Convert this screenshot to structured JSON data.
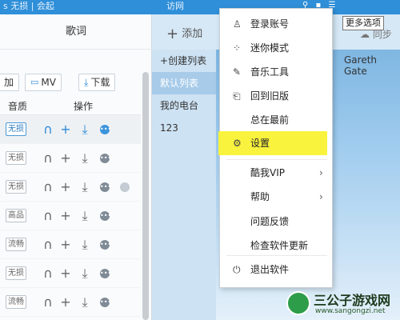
{
  "titlebar": {
    "left_text": "s 无损 | 会起",
    "center_text": "访网",
    "icons": [
      "user-icon",
      "skin-icon",
      "menu-icon"
    ]
  },
  "left_panel": {
    "lyrics_tab": "歌词",
    "buttons": {
      "add_partial": "加",
      "mv": "MV",
      "download": "下载"
    },
    "columns": {
      "quality": "音质",
      "actions": "操作"
    },
    "rows": [
      {
        "quality": "无损",
        "highlighted": true
      },
      {
        "quality": "无损",
        "highlighted": false
      },
      {
        "quality": "无损",
        "highlighted": false
      },
      {
        "quality": "高品",
        "highlighted": false
      },
      {
        "quality": "流畅",
        "highlighted": false
      },
      {
        "quality": "无损",
        "highlighted": false
      },
      {
        "quality": "流畅",
        "highlighted": false
      }
    ]
  },
  "mid_panel": {
    "add_label": "添加",
    "create_list": "创建列表",
    "items": [
      "默认列表",
      "我的电台",
      "123"
    ],
    "selected_index": 0
  },
  "right_panel": {
    "artist": "Gareth Gate",
    "sync_label": "同步"
  },
  "tooltip": "更多选项",
  "menu": {
    "items": [
      {
        "label": "登录账号",
        "icon": "user-icon"
      },
      {
        "label": "迷你模式",
        "icon": "mini-mode-icon"
      },
      {
        "label": "音乐工具",
        "icon": "tools-icon"
      },
      {
        "label": "回到旧版",
        "icon": "old-version-icon"
      },
      {
        "label": "总在最前",
        "icon": ""
      },
      {
        "label": "设置",
        "icon": "gear-icon",
        "highlighted": true
      },
      {
        "label": "酷我VIP",
        "icon": "",
        "submenu": true
      },
      {
        "label": "帮助",
        "icon": "",
        "submenu": true
      },
      {
        "label": "问题反馈",
        "icon": ""
      },
      {
        "label": "检查软件更新",
        "icon": ""
      },
      {
        "label": "退出软件",
        "icon": "exit-icon"
      }
    ]
  },
  "watermark": {
    "title": "三公子游戏网",
    "url": "www.sangongzi.net"
  },
  "colors": {
    "highlight": "#f9f33e",
    "accent": "#2f8fd8"
  }
}
